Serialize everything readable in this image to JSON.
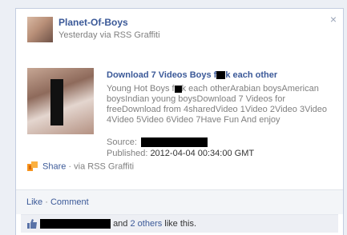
{
  "post": {
    "page_name": "Planet-Of-Boys",
    "meta": "Yesterday via RSS Graffiti",
    "close_symbol": "×"
  },
  "attachment": {
    "title_before": "Download 7 Videos Boys f",
    "title_after": "k each other",
    "description_lines": [
      [
        "Young Hot Boys f",
        "k each otherArabian boysAmerican"
      ],
      [
        "boysIndian young boysDownload 7 Videos for"
      ],
      [
        "freeDownload from 4sharedVideo 1Video 2Video 3Video"
      ],
      [
        "4Video 5Video 6Video 7Have Fun And enjoy"
      ]
    ],
    "source_label": "Source:",
    "published_label": "Published:",
    "published_value": "2012-04-04 00:34:00 GMT"
  },
  "share": {
    "share_label": "Share",
    "via_label": "· via RSS Graffiti"
  },
  "actions": {
    "like_label": "Like",
    "separator": "·",
    "comment_label": "Comment"
  },
  "likes": {
    "and_text": "and",
    "others_link": "2 others",
    "suffix": "like this."
  },
  "colors": {
    "link": "#3b5998",
    "muted": "#808080",
    "share_icon": "#f7941d"
  }
}
